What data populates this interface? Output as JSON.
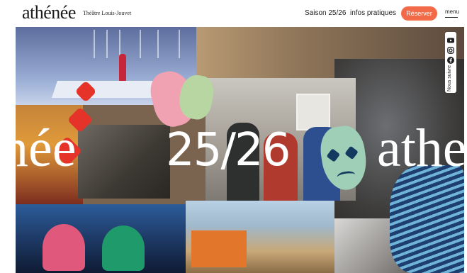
{
  "header": {
    "logo": "athénée",
    "subtitle": "Théâtre Louis-Jouvet",
    "nav": [
      {
        "label": "Saison 25/26"
      },
      {
        "label": "infos pratiques"
      }
    ],
    "reserve_label": "Réserver",
    "menu_label": "menu"
  },
  "hero": {
    "season": "25/26",
    "wordmark_left": "née",
    "wordmark_right": "athe"
  },
  "social": {
    "label": "Nous suivre",
    "icons": [
      "youtube-icon",
      "instagram-icon",
      "facebook-icon"
    ]
  },
  "colors": {
    "accent": "#f26a47",
    "text": "#222222",
    "background": "#ffffff"
  }
}
